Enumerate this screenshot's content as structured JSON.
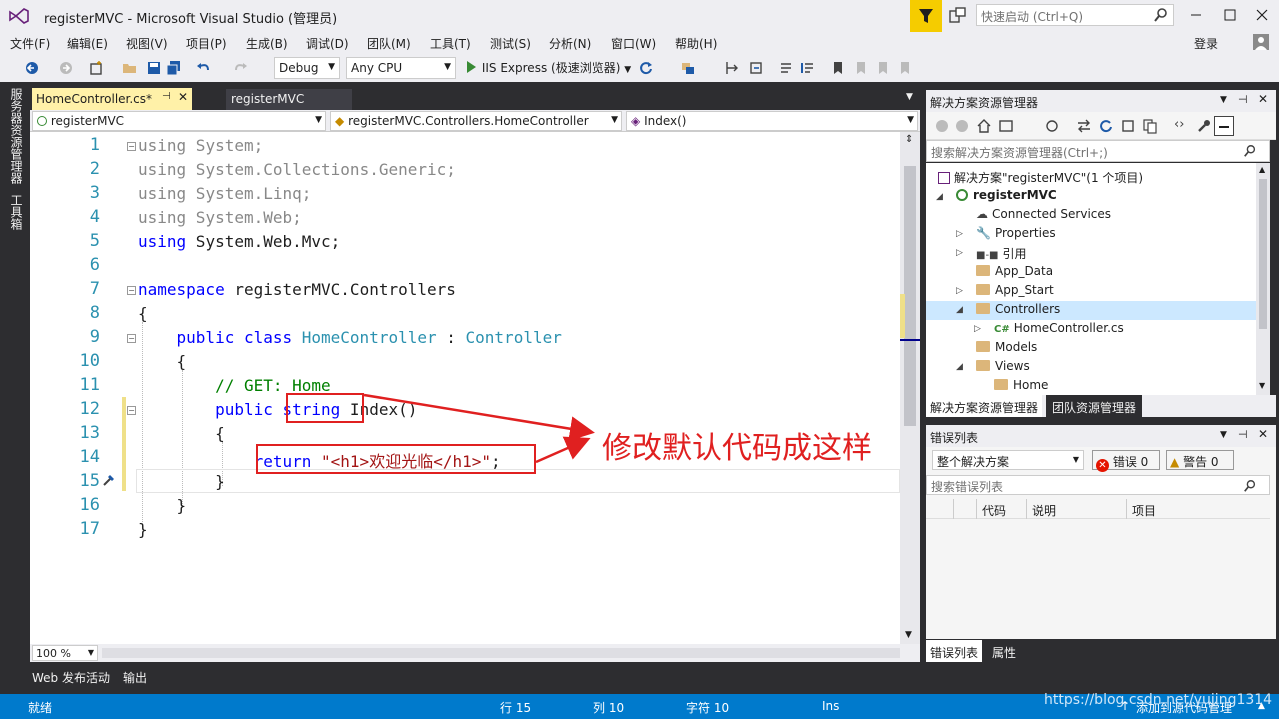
{
  "window": {
    "title": "registerMVC - Microsoft Visual Studio (管理员)",
    "quick_launch_placeholder": "快速启动 (Ctrl+Q)"
  },
  "menu": {
    "items": [
      "文件(F)",
      "编辑(E)",
      "视图(V)",
      "项目(P)",
      "生成(B)",
      "调试(D)",
      "团队(M)",
      "工具(T)",
      "测试(S)",
      "分析(N)",
      "窗口(W)",
      "帮助(H)"
    ],
    "login": "登录"
  },
  "toolbar": {
    "config": "Debug",
    "platform": "Any CPU",
    "run_label": "IIS Express (极速浏览器)"
  },
  "left_rail": {
    "server_explorer": "服务器资源管理器",
    "toolbox": "工具箱"
  },
  "editor": {
    "tabs": [
      {
        "label": "HomeController.cs*",
        "active": true
      },
      {
        "label": "registerMVC",
        "active": false
      }
    ],
    "nav": {
      "project": "registerMVC",
      "class": "registerMVC.Controllers.HomeController",
      "member": "Index()"
    },
    "line_numbers": [
      "1",
      "2",
      "3",
      "4",
      "5",
      "6",
      "7",
      "8",
      "9",
      "10",
      "11",
      "12",
      "13",
      "14",
      "15",
      "16",
      "17"
    ],
    "code": {
      "l1_kw": "using",
      "l1_rest": " System;",
      "l2_kw": "using",
      "l2_rest": " System.Collections.Generic;",
      "l3_kw": "using",
      "l3_rest": " System.Linq;",
      "l4_kw": "using",
      "l4_rest": " System.Web;",
      "l5_kw": "using",
      "l5_rest": " System.Web.Mvc;",
      "l7_kw": "namespace",
      "l7_rest": " registerMVC.Controllers",
      "l8": "{",
      "l9_kw1": "public",
      "l9_kw2": " class",
      "l9_type1": " HomeController",
      "l9_colon": " :",
      "l9_type2": " Controller",
      "l10": "{",
      "l11": "// GET: Home",
      "l12_kw1": "public",
      "l12_kw2": "string",
      "l12_rest": " Index()",
      "l13": "{",
      "l14_kw": "return",
      "l14_str": " \"<h1>欢迎光临</h1>\"",
      "l14_end": ";",
      "l15": "}",
      "l16": "}",
      "l17": "}"
    },
    "zoom": "100 %"
  },
  "bottom_tabs": [
    "Web 发布活动",
    "输出"
  ],
  "solution_explorer": {
    "title": "解决方案资源管理器",
    "search_placeholder": "搜索解决方案资源管理器(Ctrl+;)",
    "tree": [
      {
        "label": "解决方案\"registerMVC\"(1 个项目)"
      },
      {
        "label": "registerMVC"
      },
      {
        "label": "Connected Services"
      },
      {
        "label": "Properties"
      },
      {
        "label": "引用"
      },
      {
        "label": "App_Data"
      },
      {
        "label": "App_Start"
      },
      {
        "label": "Controllers"
      },
      {
        "label": "HomeController.cs"
      },
      {
        "label": "Models"
      },
      {
        "label": "Views"
      },
      {
        "label": "Home"
      }
    ],
    "tabs": [
      "解决方案资源管理器",
      "团队资源管理器"
    ]
  },
  "error_list": {
    "title": "错误列表",
    "scope": "整个解决方案",
    "errors_label": "错误 0",
    "warnings_label": "警告 0",
    "search_placeholder": "搜索错误列表",
    "columns": [
      "代码",
      "说明",
      "项目"
    ],
    "tabs": [
      "错误列表",
      "属性"
    ]
  },
  "status_bar": {
    "ready": "就绪",
    "line": "行 15",
    "col": "列 10",
    "char": "字符 10",
    "ins": "Ins",
    "source_control": "添加到源代码管理"
  },
  "annotation": {
    "text": "修改默认代码成这样"
  },
  "watermark": "https://blog.csdn.net/yujing1314"
}
